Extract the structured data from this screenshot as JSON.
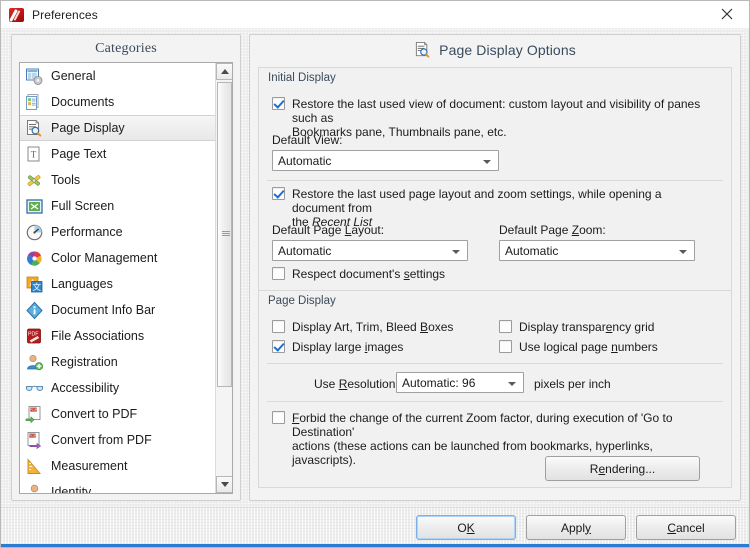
{
  "window": {
    "title": "Preferences",
    "app_icon": "pdfxchange-icon",
    "close_label": "close-icon",
    "accent_color": "#2b7dd1"
  },
  "categories_panel": {
    "header": "Categories",
    "selected": "Page Display",
    "items": [
      {
        "label": "General",
        "icon": "general-icon"
      },
      {
        "label": "Documents",
        "icon": "documents-icon"
      },
      {
        "label": "Page Display",
        "icon": "page-display-icon"
      },
      {
        "label": "Page Text",
        "icon": "page-text-icon"
      },
      {
        "label": "Tools",
        "icon": "tools-icon"
      },
      {
        "label": "Full Screen",
        "icon": "full-screen-icon"
      },
      {
        "label": "Performance",
        "icon": "performance-icon"
      },
      {
        "label": "Color Management",
        "icon": "color-management-icon"
      },
      {
        "label": "Languages",
        "icon": "languages-icon"
      },
      {
        "label": "Document Info Bar",
        "icon": "info-icon"
      },
      {
        "label": "File Associations",
        "icon": "file-associations-icon"
      },
      {
        "label": "Registration",
        "icon": "registration-icon"
      },
      {
        "label": "Accessibility",
        "icon": "accessibility-icon"
      },
      {
        "label": "Convert to PDF",
        "icon": "convert-to-pdf-icon"
      },
      {
        "label": "Convert from PDF",
        "icon": "convert-from-pdf-icon"
      },
      {
        "label": "Measurement",
        "icon": "measurement-icon"
      },
      {
        "label": "Identity",
        "icon": "identity-icon"
      }
    ],
    "scrollbar": {
      "up": "scroll-up-arrow",
      "down": "scroll-down-arrow"
    }
  },
  "options_panel": {
    "title": "Page Display Options",
    "title_icon": "page-display-icon",
    "initial_display": {
      "legend": "Initial Display",
      "restore_view": {
        "checked": true,
        "line1": "Restore the last used view of document: custom layout and visibility of panes such as",
        "line2": "Bookmarks pane, Thumbnails pane, etc."
      },
      "default_view_label": "Default View:",
      "default_view_value": "Automatic",
      "restore_layout": {
        "checked": true,
        "line1_a": "Restore the last used page layout and zoom settings, while opening a document from",
        "line2_a": "the ",
        "line2_italic": "Recent List"
      },
      "default_page_layout_label_pre": "Default Page ",
      "default_page_layout_label_key": "L",
      "default_page_layout_label_post": "ayout:",
      "default_page_layout_value": "Automatic",
      "default_page_zoom_label_pre": "Default Page ",
      "default_page_zoom_label_key": "Z",
      "default_page_zoom_label_post": "oom:",
      "default_page_zoom_value": "Automatic",
      "respect_settings": {
        "checked": false,
        "text_pre": "Respect document's ",
        "text_key": "s",
        "text_post": "ettings"
      }
    },
    "page_display": {
      "legend": "Page Display",
      "display_boxes": {
        "checked": false,
        "text_pre": "Display Art, Trim, Bleed ",
        "text_key": "B",
        "text_post": "oxes"
      },
      "display_large_images": {
        "checked": true,
        "text_pre": "Display large ",
        "text_key": "i",
        "text_post": "mages"
      },
      "transparency_grid": {
        "checked": false,
        "text_pre": "Display transpar",
        "text_key": "e",
        "text_post": "ncy grid"
      },
      "logical_page_numbers": {
        "checked": false,
        "text_pre": "Use logical page ",
        "text_key": "n",
        "text_post": "umbers"
      },
      "resolution_label_pre": "Use ",
      "resolution_label_key": "R",
      "resolution_label_post": "esolution:",
      "resolution_value": "Automatic: 96",
      "resolution_units": "pixels per inch",
      "forbid_zoom": {
        "checked": false,
        "text_key": "F",
        "line1_post": "orbid the change of the current Zoom factor, during execution of 'Go to Destination'",
        "line2": "actions (these actions can be launched from bookmarks, hyperlinks, javascripts)."
      },
      "rendering_button_pre": "R",
      "rendering_button_key": "e",
      "rendering_button_post": "ndering..."
    }
  },
  "footer": {
    "ok_pre": "O",
    "ok_key": "K",
    "ok_post": "",
    "apply_pre": "Appl",
    "apply_key": "y",
    "apply_post": "",
    "cancel_pre": "",
    "cancel_key": "C",
    "cancel_post": "ancel"
  }
}
